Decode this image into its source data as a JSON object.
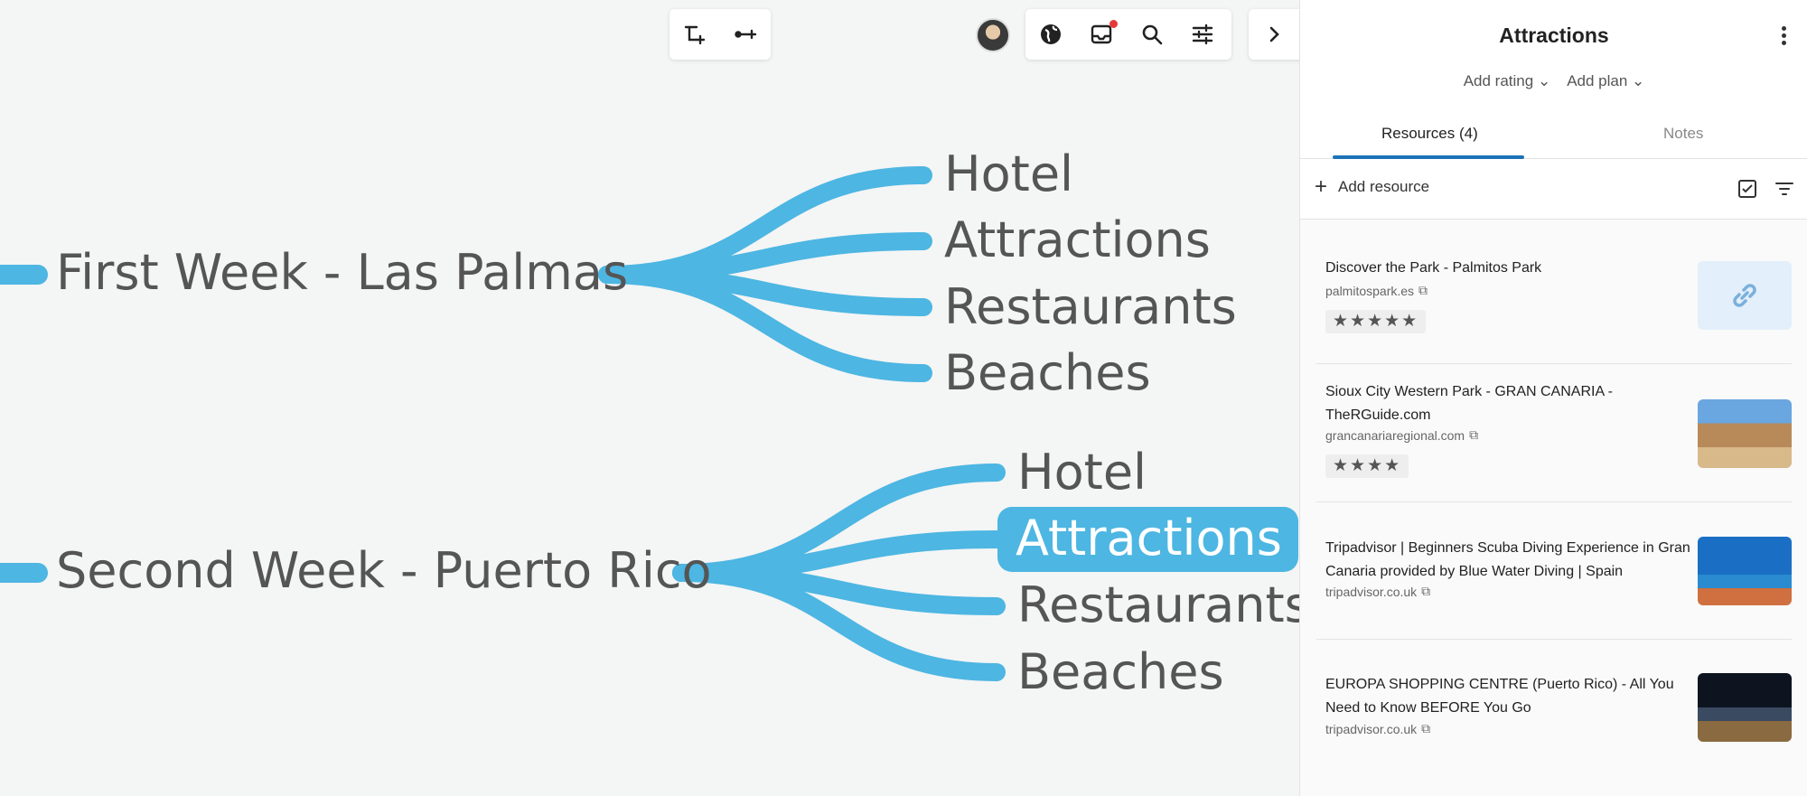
{
  "mindmap": {
    "groups": [
      {
        "title": "First Week - Las Palmas",
        "children": [
          "Hotel",
          "Attractions",
          "Restaurants",
          "Beaches"
        ]
      },
      {
        "title": "Second Week - Puerto Rico",
        "children": [
          "Hotel",
          "Attractions",
          "Restaurants",
          "Beaches"
        ]
      }
    ],
    "selected_node": "Second Week - Puerto Rico / Attractions",
    "branch_color": "#4db6e2"
  },
  "toolbars": {
    "left": [
      "add-subtopic-icon",
      "add-connection-icon"
    ],
    "right": [
      "globe-icon",
      "inbox-icon",
      "search-icon",
      "sliders-icon"
    ],
    "collapse": "chevron-right-icon",
    "notification_dot_color": "#e53935"
  },
  "sidebar": {
    "title": "Attractions",
    "add_rating_label": "Add rating",
    "add_plan_label": "Add plan",
    "tabs": [
      {
        "label": "Resources (4)",
        "active": true
      },
      {
        "label": "Notes",
        "active": false
      }
    ],
    "add_resource_label": "Add resource",
    "accent_color": "#1b73b8",
    "resources": [
      {
        "title": "Discover the Park - Palmitos Park",
        "domain": "palmitospark.es",
        "rating": 5,
        "thumbnail": "link-icon"
      },
      {
        "title": "Sioux City Western Park - GRAN CANARIA - TheRGuide.com",
        "domain": "grancanariaregional.com",
        "rating": 4,
        "thumbnail": "western-town-photo"
      },
      {
        "title": "Tripadvisor | Beginners Scuba Diving Experience in Gran Canaria provided by Blue Water Diving | Spain",
        "domain": "tripadvisor.co.uk",
        "rating": 0,
        "thumbnail": "scuba-diver-photo"
      },
      {
        "title": "EUROPA SHOPPING CENTRE (Puerto Rico) - All You Need to Know BEFORE You Go",
        "domain": "tripadvisor.co.uk",
        "rating": 0,
        "thumbnail": "night-shopping-centre-photo"
      }
    ]
  }
}
